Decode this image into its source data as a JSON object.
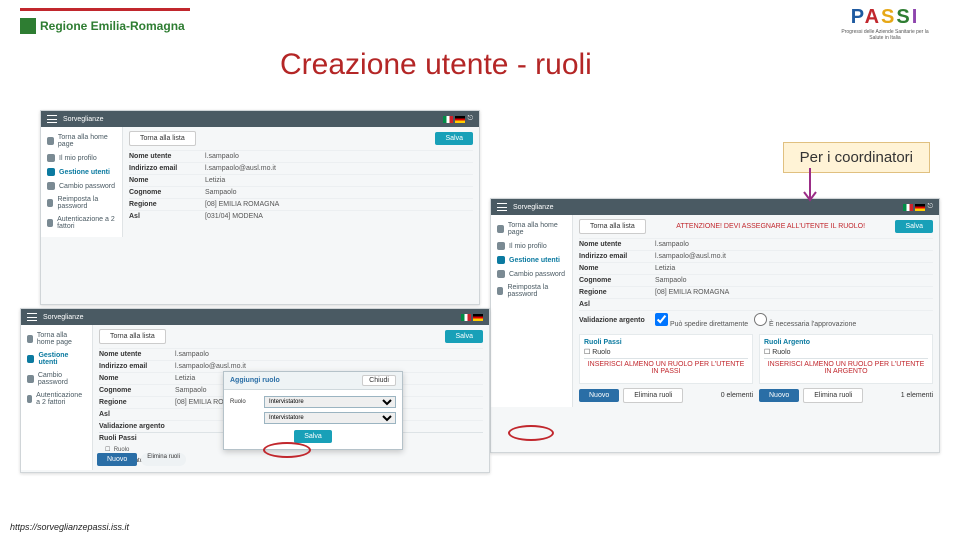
{
  "slide": {
    "logo_left": "Regione Emilia-Romagna",
    "logo_right": "PASSI",
    "logo_right_sub": "Progressi delle Aziende Sanitarie per la Salute in Italia",
    "title": "Creazione utente - ruoli",
    "callout": "Per i coordinatori",
    "footer_url": "https://sorveglianzepassi.iss.it"
  },
  "app_common": {
    "brand": "Sorveglianze",
    "side": {
      "home": "Torna alla home page",
      "profile": "Il mio profilo",
      "users": "Gestione utenti",
      "pwd": "Cambio password",
      "reset": "Reimposta la password",
      "twofa": "Autenticazione a 2 fattori"
    },
    "btn_back": "Torna alla lista",
    "btn_save": "Salva",
    "btn_new": "Nuovo",
    "btn_del": "Elimina ruoli",
    "count0": "0 elementi",
    "count1": "1 elementi"
  },
  "form": {
    "username_lbl": "Nome utente",
    "username_val": "l.sampaolo",
    "email_lbl": "Indirizzo email",
    "email_val": "l.sampaolo@ausl.mo.it",
    "name_lbl": "Nome",
    "name_val": "Letizia",
    "surname_lbl": "Cognome",
    "surname_val": "Sampaolo",
    "region_lbl": "Regione",
    "region_val": "[08] EMILIA ROMAGNA",
    "asl_lbl": "Asl",
    "asl_val": "[031/04] MODENA",
    "valid_lbl": "Validazione argento",
    "valid_opt1": "Può spedire direttamente",
    "valid_opt2": "È necessaria l'approvazione",
    "roles_passi": "Ruoli Passi",
    "roles_argento": "Ruoli Argento",
    "role_col": "Ruolo",
    "intervistatore": "Intervistatore"
  },
  "panel3": {
    "warning": "ATTENZIONE! DEVI ASSEGNARE ALL'UTENTE IL RUOLO!",
    "msg_left": "INSERISCI ALMENO UN RUOLO PER L'UTENTE IN PASSI",
    "msg_right": "INSERISCI ALMENO UN RUOLO PER L'UTENTE IN ARGENTO"
  },
  "panel2": {
    "dialog_title": "Aggiungi ruolo",
    "close": "Chiudi"
  }
}
